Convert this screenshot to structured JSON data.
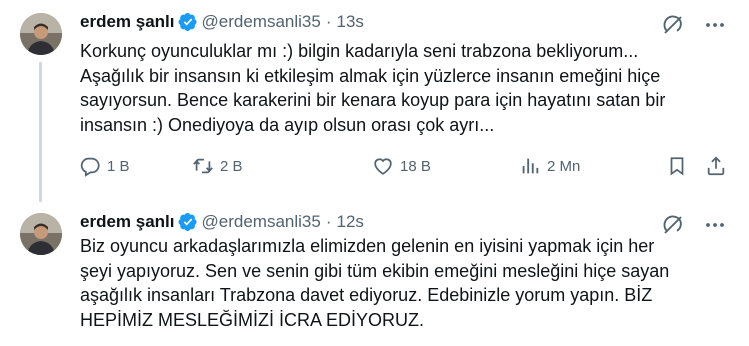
{
  "tweets": [
    {
      "display_name": "erdem şanlı",
      "handle": "@erdemsanli35",
      "separator": "·",
      "time": "13s",
      "text_lines": [
        "Korkunç oyunculuklar mı :) bilgin kadarıyla seni trabzona bekliyorum...",
        "Aşağılık bir insansın ki etkileşim almak için yüzlerce insanın emeğini hiçe",
        "sayıyorsun. Bence karakerini bir kenara koyup para için hayatını satan bir",
        "insansın :) Onediyoya da ayıp olsun orası çok ayrı..."
      ],
      "replies": "1 B",
      "retweets": "2 B",
      "likes": "18 B",
      "views": "2 Mn"
    },
    {
      "display_name": "erdem şanlı",
      "handle": "@erdemsanli35",
      "separator": "·",
      "time": "12s",
      "text_lines": [
        "Biz oyuncu arkadaşlarımızla elimizden gelenin en iyisini yapmak için her",
        "şeyi yapıyoruz. Sen ve senin gibi tüm ekibin emeğini mesleğini hiçe sayan",
        "aşağılık insanları Trabzona davet ediyoruz. Edebinizle yorum yapın. BİZ",
        "HEPİMİZ MESLEĞİMİZİ İCRA EDİYORUZ."
      ]
    }
  ],
  "icons": {
    "verified": "verified-badge-icon",
    "grok": "grok-icon",
    "more": "more-icon",
    "reply": "reply-icon",
    "retweet": "retweet-icon",
    "like": "heart-icon",
    "views": "views-icon",
    "bookmark": "bookmark-icon",
    "share": "share-icon"
  },
  "colors": {
    "verified": "#1d9bf0",
    "secondary_text": "#536471",
    "primary_text": "#0f1419",
    "thread_line": "#cfd9de"
  }
}
